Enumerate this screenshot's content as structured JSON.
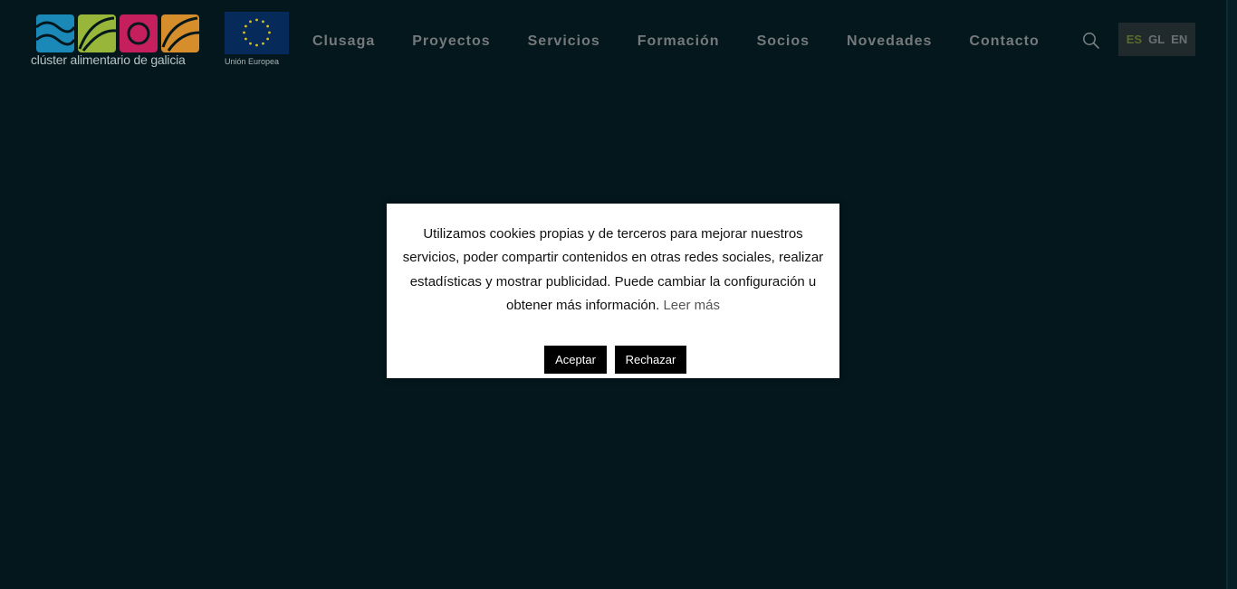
{
  "brand": {
    "logo_text": "clúster alimentario de galicia",
    "logo_colors": [
      "#1a89b8",
      "#98b73a",
      "#c61f5d",
      "#d68d2c"
    ],
    "eu_text": "Unión Europea"
  },
  "nav": {
    "items": [
      {
        "label": "Clusaga"
      },
      {
        "label": "Proyectos"
      },
      {
        "label": "Servicios"
      },
      {
        "label": "Formación"
      },
      {
        "label": "Socios"
      },
      {
        "label": "Novedades"
      },
      {
        "label": "Contacto"
      }
    ],
    "search_icon": "search-icon"
  },
  "languages": {
    "items": [
      "ES",
      "GL",
      "EN"
    ],
    "active": "ES"
  },
  "cookie_banner": {
    "message": "Utilizamos cookies propias y de terceros para mejorar nuestros servicios, poder compartir contenidos en otras redes sociales, realizar estadísticas y mostrar publicidad. Puede cambiar la configuración u obtener más información.",
    "read_more": "Leer más",
    "accept_label": "Aceptar",
    "reject_label": "Rechazar"
  },
  "colors": {
    "background": "#03171d",
    "nav_text": "#75797b",
    "lang_active": "#5b6b2a"
  }
}
